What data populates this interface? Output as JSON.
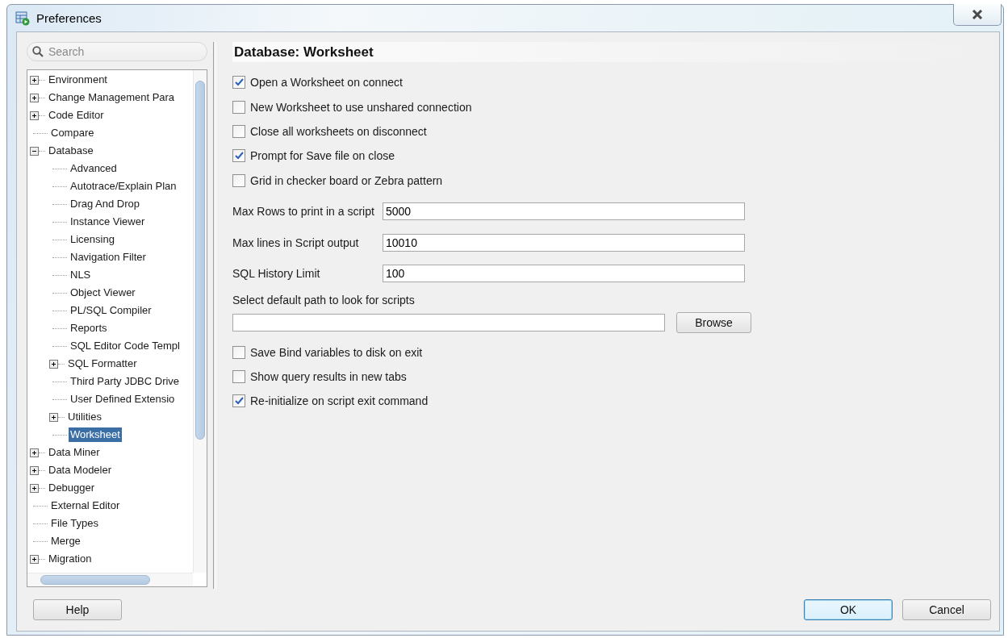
{
  "window": {
    "title": "Preferences"
  },
  "search": {
    "placeholder": "Search"
  },
  "tree": [
    {
      "label": "Environment",
      "expanded": false,
      "selected": false
    },
    {
      "label": "Change Management Para",
      "expanded": false,
      "selected": false
    },
    {
      "label": "Code Editor",
      "expanded": false,
      "selected": false
    },
    {
      "label": "Compare",
      "selected": false
    },
    {
      "label": "Database",
      "expanded": true,
      "selected": false,
      "children": [
        {
          "label": "Advanced",
          "selected": false
        },
        {
          "label": "Autotrace/Explain Plan",
          "selected": false
        },
        {
          "label": "Drag And Drop",
          "selected": false
        },
        {
          "label": "Instance Viewer",
          "selected": false
        },
        {
          "label": "Licensing",
          "selected": false
        },
        {
          "label": "Navigation Filter",
          "selected": false
        },
        {
          "label": "NLS",
          "selected": false
        },
        {
          "label": "Object Viewer",
          "selected": false
        },
        {
          "label": "PL/SQL Compiler",
          "selected": false
        },
        {
          "label": "Reports",
          "selected": false
        },
        {
          "label": "SQL Editor Code Templ",
          "selected": false
        },
        {
          "label": "SQL Formatter",
          "expanded": false,
          "selected": false
        },
        {
          "label": "Third Party JDBC Drive",
          "selected": false
        },
        {
          "label": "User Defined Extensio",
          "selected": false
        },
        {
          "label": "Utilities",
          "expanded": false,
          "selected": false
        },
        {
          "label": "Worksheet",
          "selected": true
        }
      ]
    },
    {
      "label": "Data Miner",
      "expanded": false,
      "selected": false
    },
    {
      "label": "Data Modeler",
      "expanded": false,
      "selected": false
    },
    {
      "label": "Debugger",
      "expanded": false,
      "selected": false
    },
    {
      "label": "External Editor",
      "selected": false
    },
    {
      "label": "File Types",
      "selected": false
    },
    {
      "label": "Merge",
      "selected": false
    },
    {
      "label": "Migration",
      "expanded": false,
      "selected": false
    }
  ],
  "panel": {
    "title": "Database: Worksheet",
    "options_top": [
      {
        "label": "Open a Worksheet on connect",
        "checked": true
      },
      {
        "label": "New Worksheet to use unshared connection",
        "checked": false
      },
      {
        "label": "Close all worksheets on disconnect",
        "checked": false
      },
      {
        "label": "Prompt for Save file on close",
        "checked": true
      },
      {
        "label": "Grid in checker board or Zebra pattern",
        "checked": false
      }
    ],
    "fields": [
      {
        "label": "Max Rows to print in a script",
        "value": "5000"
      },
      {
        "label": "Max lines in Script output",
        "value": "10010"
      },
      {
        "label": "SQL History Limit",
        "value": "100"
      }
    ],
    "path": {
      "label": "Select default path to look for scripts",
      "button": "Browse"
    },
    "options_bottom": [
      {
        "label": "Save Bind variables to disk on exit",
        "checked": false
      },
      {
        "label": "Show query results in new tabs",
        "checked": false
      },
      {
        "label": "Re-initialize on script exit command",
        "checked": true
      }
    ]
  },
  "buttons": {
    "help": "Help",
    "ok": "OK",
    "cancel": "Cancel"
  }
}
